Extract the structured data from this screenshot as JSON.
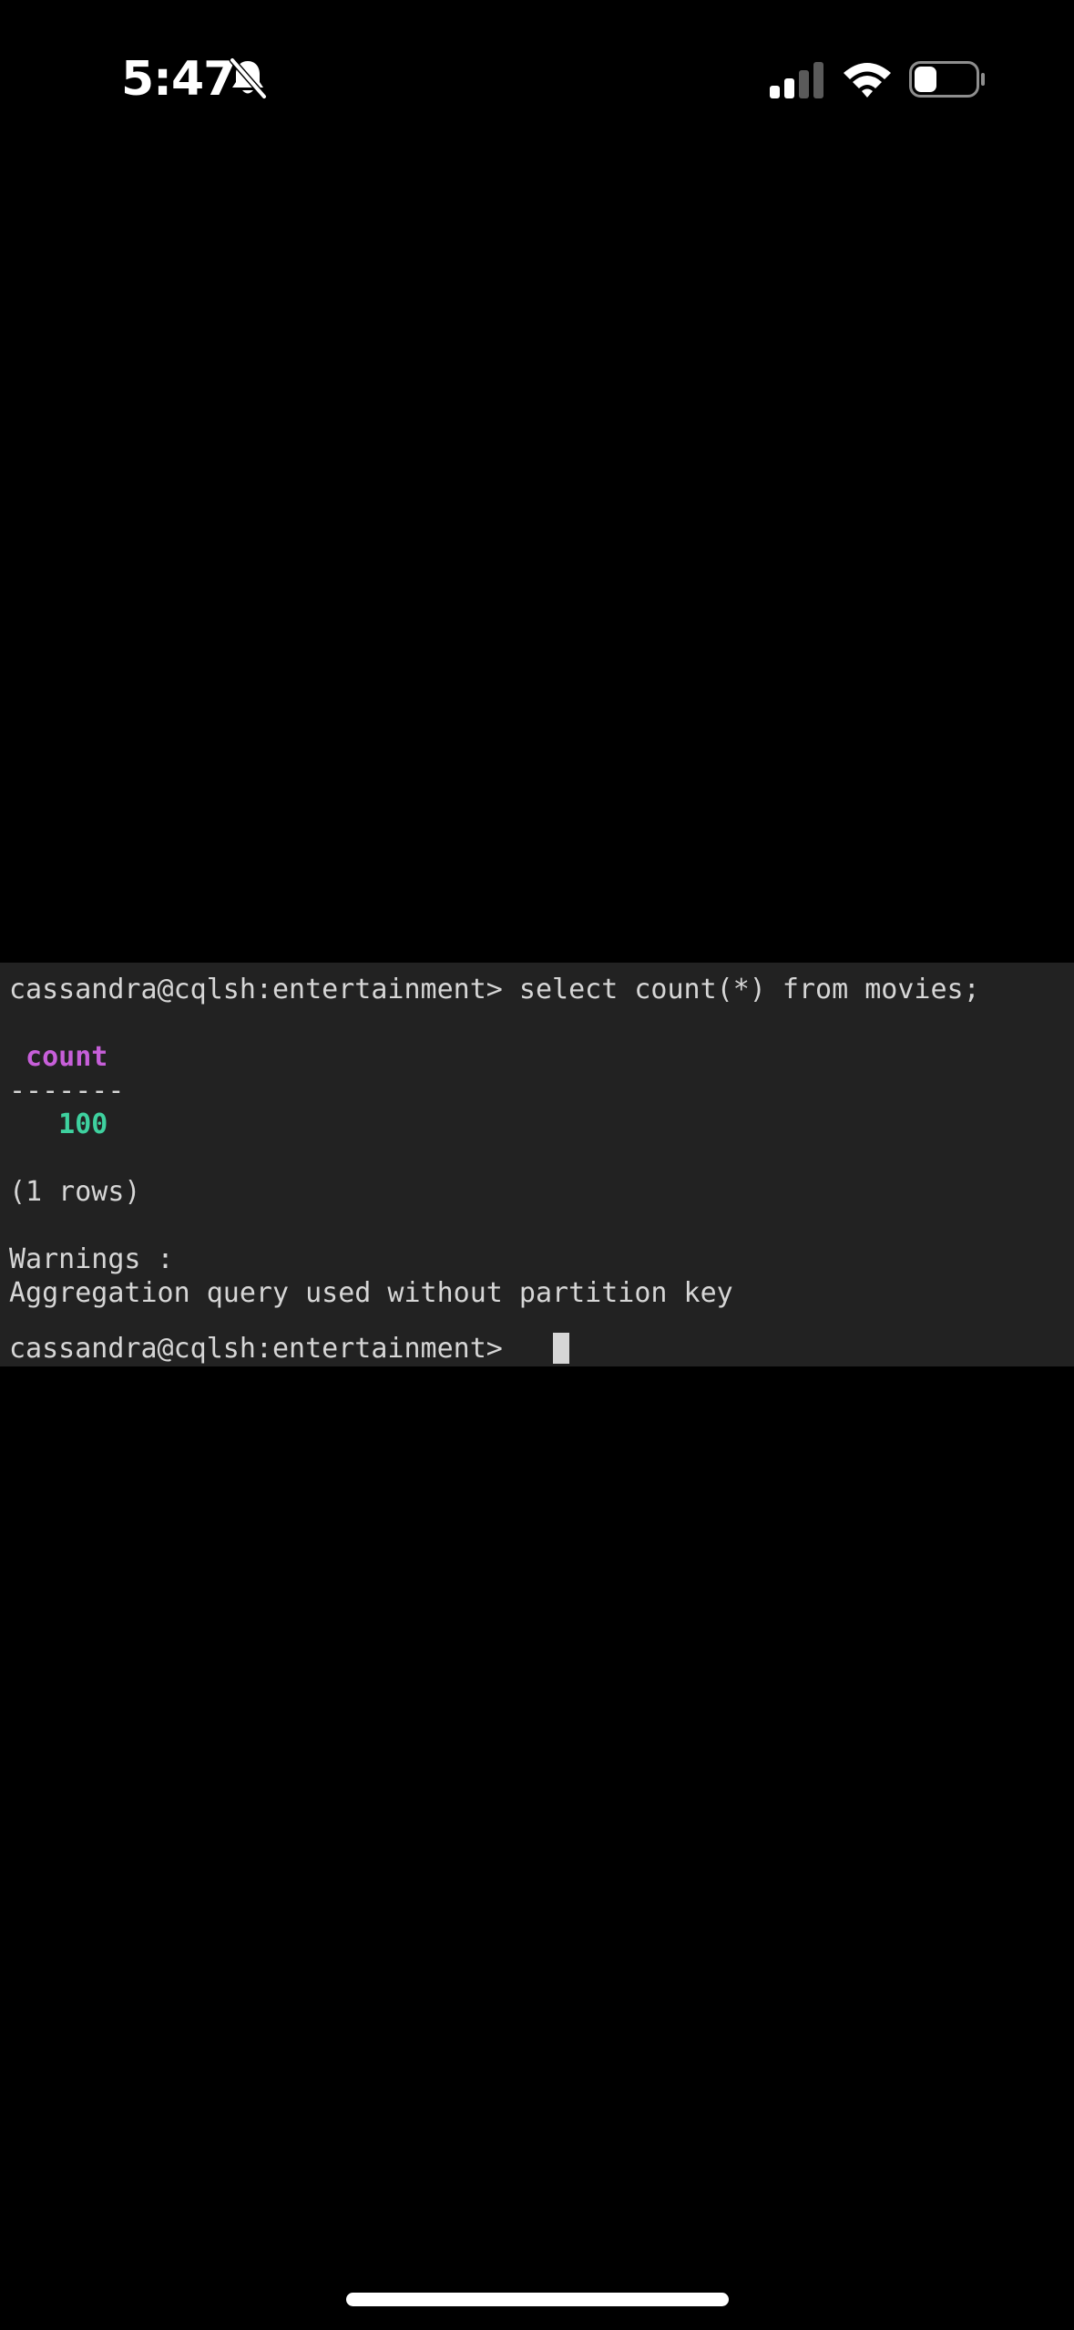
{
  "status_bar": {
    "time": "5:47",
    "icons": [
      "bell-slash-icon",
      "cellular-signal-icon",
      "wifi-icon",
      "battery-icon"
    ],
    "signal_bars_active": 2,
    "signal_bars_total": 4,
    "battery_level": 0.3
  },
  "terminal": {
    "background": "#222222",
    "text_color": "#d6d6d6",
    "header_color": "#c75fd9",
    "value_color": "#3ed19f",
    "lines": {
      "command": "cassandra@cqlsh:entertainment> select count(*) from movies;",
      "column_header": " count",
      "separator": "-------",
      "value": "   100",
      "row_count": "(1 rows)",
      "warnings_label": "Warnings :",
      "warning_message": "Aggregation query used without partition key",
      "prompt": "cassandra@cqlsh:entertainment> "
    }
  }
}
